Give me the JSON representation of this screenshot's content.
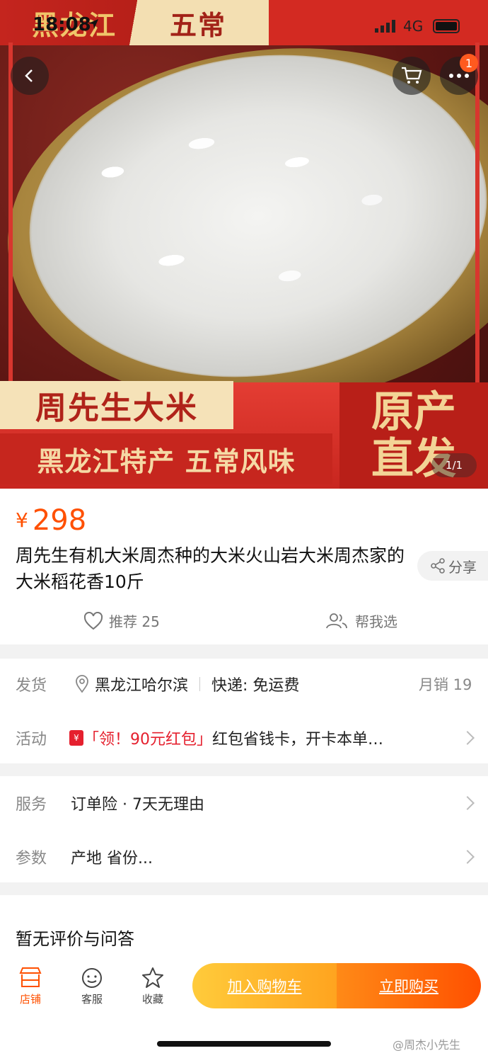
{
  "status_bar": {
    "time": "18:08",
    "network": "4G"
  },
  "hero": {
    "top_tag_left": "黑龙江",
    "top_tag_right": "五常",
    "main_title": "周先生大米",
    "subtitle": "黑龙江特产  五常风味",
    "right_line1": "原产",
    "right_line2": "直发",
    "pager": "1/1",
    "cart_badge": "1"
  },
  "product": {
    "currency": "¥",
    "price": "298",
    "title": "周先生有机大米周杰种的大米火山岩大米周杰家的大米稻花香10斤",
    "share_label": "分享",
    "recommend_label": "推荐 25",
    "help_label": "帮我选"
  },
  "delivery": {
    "label": "发货",
    "location": "黑龙江哈尔滨",
    "shipping": "快递: 免运费",
    "monthly_sales": "月销 19"
  },
  "promotion": {
    "label": "活动",
    "highlight": "「领！90元红包」",
    "text": "红包省钱卡，开卡本单…"
  },
  "service": {
    "label": "服务",
    "value": "订单险 · 7天无理由"
  },
  "params": {
    "label": "参数",
    "value": "产地 省份..."
  },
  "reviews": {
    "text": "暂无评价与问答"
  },
  "bottom_bar": {
    "store": "店铺",
    "service": "客服",
    "favorite": "收藏",
    "add_to_cart": "加入购物车",
    "buy_now": "立即购买"
  },
  "watermark": "@周杰小先生",
  "colors": {
    "accent": "#ff5000",
    "red": "#e5202e"
  }
}
